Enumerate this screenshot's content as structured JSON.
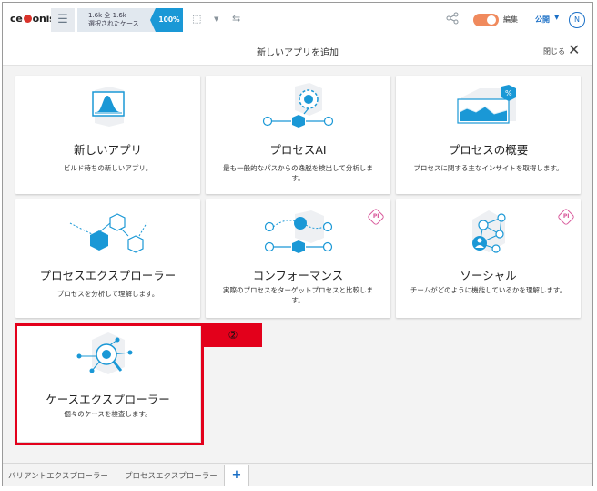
{
  "toolbar": {
    "logo": "celonis",
    "selection_line1": "1.6k 全 1.6k",
    "selection_line2": "選択されたケース",
    "percent": "100%",
    "edit_label": "編集",
    "publish_label": "公開",
    "avatar_letter": "N"
  },
  "dialog": {
    "title": "新しいアプリを追加",
    "close_label": "閉じる"
  },
  "cards": [
    {
      "title": "新しいアプリ",
      "desc": "ビルド待ちの新しいアプリ。"
    },
    {
      "title": "プロセスAI",
      "desc": "最も一般的なパスからの逸脱を検出して分析します。"
    },
    {
      "title": "プロセスの概要",
      "desc": "プロセスに関する主なインサイトを取得します。"
    },
    {
      "title": "プロセスエクスプローラー",
      "desc": "プロセスを分析して理解します。"
    },
    {
      "title": "コンフォーマンス",
      "desc": "実際のプロセスをターゲットプロセスと比較します。",
      "badge": "PI"
    },
    {
      "title": "ソーシャル",
      "desc": "チームがどのように機能しているかを理解します。",
      "badge": "PI"
    },
    {
      "title": "ケースエクスプローラー",
      "desc": "個々のケースを検査します。"
    }
  ],
  "annotation": {
    "label": "②",
    "color": "#e3001b"
  },
  "bottom_tabs": [
    "バリアントエクスプローラー",
    "プロセスエクスプローラー"
  ],
  "add_tab": "+",
  "colors": {
    "accent": "#1a98d6",
    "dark_blue": "#1a6fc6",
    "toggle": "#f08a5d"
  }
}
